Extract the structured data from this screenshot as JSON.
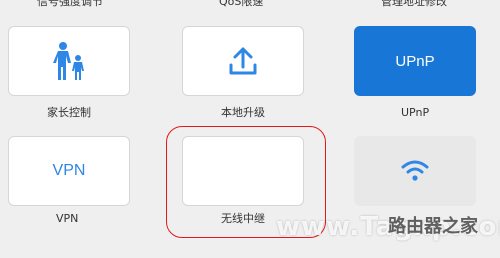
{
  "top_row_labels": [
    "信号强度调节",
    "QoS限速",
    "管理地址修改"
  ],
  "tiles": [
    {
      "label": "家长控制",
      "icon": "parental-control-icon",
      "content": ""
    },
    {
      "label": "本地升级",
      "icon": "upload-icon",
      "content": ""
    },
    {
      "label": "UPnP",
      "icon": "",
      "content": "UPnP"
    },
    {
      "label": "VPN",
      "icon": "",
      "content": "VPN"
    },
    {
      "label": "无线中继",
      "icon": "",
      "content": ""
    },
    {
      "label": "",
      "icon": "wifi-icon",
      "content": ""
    }
  ],
  "watermark": {
    "text": "www.Tagxp.com",
    "logo_text": "路由器之家"
  },
  "colors": {
    "accent_blue": "#1877d6",
    "icon_blue": "#2e86e6",
    "highlight_red": "#e01a1a",
    "background": "#efefef"
  }
}
